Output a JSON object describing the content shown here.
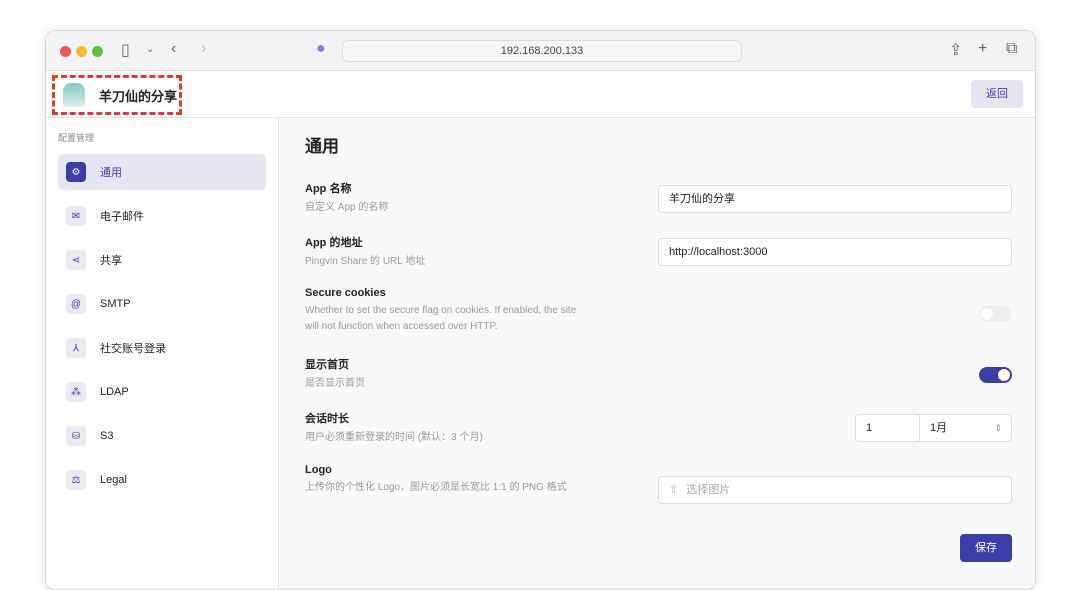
{
  "browser": {
    "url": "192.168.200.133"
  },
  "header": {
    "site_name": "羊刀仙的分享",
    "back_label": "返回"
  },
  "sidebar": {
    "heading": "配置管理",
    "items": [
      {
        "label": "通用",
        "icon": "gear-icon"
      },
      {
        "label": "电子邮件",
        "icon": "mail-icon"
      },
      {
        "label": "共享",
        "icon": "share-icon"
      },
      {
        "label": "SMTP",
        "icon": "at-icon"
      },
      {
        "label": "社交账号登录",
        "icon": "social-icon"
      },
      {
        "label": "LDAP",
        "icon": "ldap-icon"
      },
      {
        "label": "S3",
        "icon": "bucket-icon"
      },
      {
        "label": "Legal",
        "icon": "scale-icon"
      }
    ]
  },
  "main": {
    "title": "通用",
    "app_name": {
      "label": "App 名称",
      "desc": "自定义 App 的名称",
      "value": "羊刀仙的分享"
    },
    "app_url": {
      "label": "App 的地址",
      "desc": "Pingvin Share 的 URL 地址",
      "value": "http://localhost:3000"
    },
    "secure_cookies": {
      "label": "Secure cookies",
      "desc": "Whether to set the secure flag on cookies. If enabled, the site will not function when accessed over HTTP.",
      "enabled": false
    },
    "show_home": {
      "label": "显示首页",
      "desc": "是否显示首页",
      "enabled": true
    },
    "session": {
      "label": "会话时长",
      "desc": "用户必须重新登录的时间 (默认：3 个月)",
      "value": "1",
      "unit": "1月"
    },
    "logo": {
      "label": "Logo",
      "desc": "上传你的个性化 Logo，图片必须是长宽比 1:1 的 PNG 格式",
      "placeholder": "选择图片"
    },
    "save_label": "保存"
  }
}
